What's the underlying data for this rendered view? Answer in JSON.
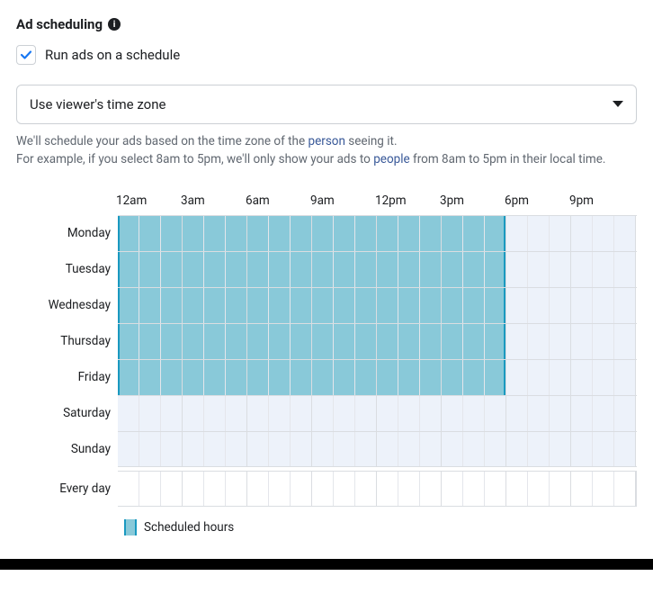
{
  "heading": "Ad scheduling",
  "checkbox": {
    "checked": true,
    "label": "Run ads on a schedule"
  },
  "select": {
    "value": "Use viewer's time zone"
  },
  "desc": {
    "line1_a": "We'll schedule your ads based on the time zone of the ",
    "line1_link": "person",
    "line1_b": " seeing it.",
    "line2_a": "For example, if you select 8am to 5pm, we'll only show your ads to ",
    "line2_link": "people",
    "line2_b": " from 8am to 5pm in their local time."
  },
  "hours_header": [
    "12am",
    "3am",
    "6am",
    "9am",
    "12pm",
    "3pm",
    "6pm",
    "9pm"
  ],
  "days": [
    "Monday",
    "Tuesday",
    "Wednesday",
    "Thursday",
    "Friday",
    "Saturday",
    "Sunday"
  ],
  "everyday_label": "Every day",
  "legend_label": "Scheduled hours",
  "schedule": {
    "Monday": [
      0,
      18
    ],
    "Tuesday": [
      0,
      18
    ],
    "Wednesday": [
      0,
      18
    ],
    "Thursday": [
      0,
      18
    ],
    "Friday": [
      0,
      18
    ],
    "Saturday": null,
    "Sunday": null
  }
}
